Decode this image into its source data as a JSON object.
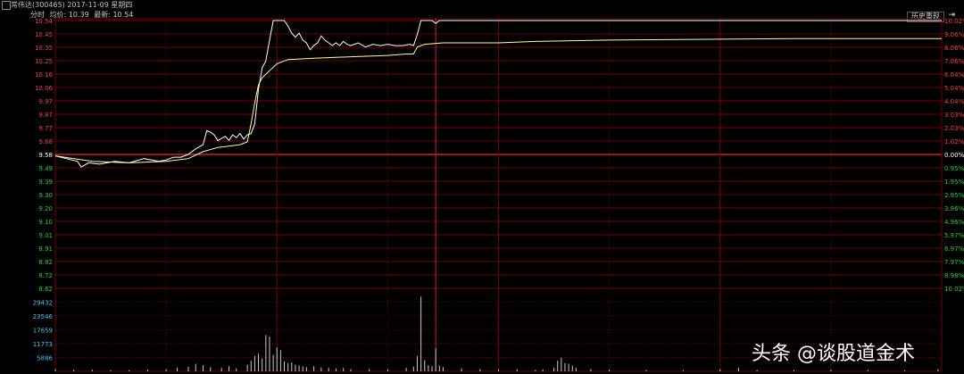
{
  "window": {
    "title": "常伟达(300465) 2017-11-09 星期四",
    "legend_time": "分时",
    "legend_avg": "均价: 10.39",
    "legend_last": "最新: 10.54",
    "history_button": "历史重现",
    "history_arrow": "⇥"
  },
  "watermark": "头条 @谈股道金术",
  "colors": {
    "background": "#000000",
    "grid": "#7a0000",
    "price_line": "#ffffff",
    "avg_line": "#ffff99",
    "prev_close_line": "#cc2222",
    "up_label": "#ff4040",
    "down_label": "#30d030",
    "volume_label": "#4fc3f7",
    "volume_bar": "#c8c8c8"
  },
  "chart_data": {
    "type": "line",
    "title": "",
    "xlabel": "",
    "ylabel": "",
    "prev_close": 9.58,
    "ylim": [
      8.62,
      10.54
    ],
    "y_ticks_left": [
      "10.54",
      "10.45",
      "10.35",
      "10.25",
      "10.16",
      "10.06",
      "9.97",
      "9.87",
      "9.77",
      "9.68",
      "9.58",
      "9.49",
      "9.39",
      "9.30",
      "9.20",
      "9.10",
      "9.01",
      "8.91",
      "8.82",
      "8.72",
      "8.62"
    ],
    "y_ticks_right": [
      "10.02%",
      "9.06%",
      "8.06%",
      "7.06%",
      "6.04%",
      "5.04%",
      "4.04%",
      "3.03%",
      "2.03%",
      "1.02%",
      "0.00%",
      "0.95%",
      "1.95%",
      "2.95%",
      "3.96%",
      "4.96%",
      "5.97%",
      "6.97%",
      "7.97%",
      "8.98%",
      "10.02%"
    ],
    "volume_ticks": [
      "29432",
      "23546",
      "17659",
      "11773",
      "5886"
    ],
    "volume_max": 35318,
    "minutes": 240,
    "marker_minute": 103,
    "series": [
      {
        "name": "",
        "role": "price",
        "points": [
          [
            0,
            9.57
          ],
          [
            3,
            9.55
          ],
          [
            6,
            9.53
          ],
          [
            7,
            9.49
          ],
          [
            9,
            9.52
          ],
          [
            12,
            9.51
          ],
          [
            16,
            9.53
          ],
          [
            20,
            9.52
          ],
          [
            24,
            9.55
          ],
          [
            28,
            9.53
          ],
          [
            30,
            9.54
          ],
          [
            32,
            9.56
          ],
          [
            34,
            9.56
          ],
          [
            36,
            9.58
          ],
          [
            38,
            9.62
          ],
          [
            40,
            9.65
          ],
          [
            41,
            9.75
          ],
          [
            42,
            9.74
          ],
          [
            43,
            9.72
          ],
          [
            44,
            9.68
          ],
          [
            46,
            9.71
          ],
          [
            47,
            9.68
          ],
          [
            48,
            9.72
          ],
          [
            49,
            9.7
          ],
          [
            50,
            9.73
          ],
          [
            51,
            9.69
          ],
          [
            52,
            9.72
          ],
          [
            53,
            9.73
          ],
          [
            54,
            9.8
          ],
          [
            55,
            10.05
          ],
          [
            56,
            10.2
          ],
          [
            57,
            10.25
          ],
          [
            58,
            10.4
          ],
          [
            59,
            10.54
          ],
          [
            60,
            10.54
          ],
          [
            61,
            10.54
          ],
          [
            62,
            10.54
          ],
          [
            63,
            10.5
          ],
          [
            64,
            10.45
          ],
          [
            65,
            10.42
          ],
          [
            66,
            10.45
          ],
          [
            67,
            10.4
          ],
          [
            68,
            10.38
          ],
          [
            69,
            10.33
          ],
          [
            70,
            10.36
          ],
          [
            71,
            10.38
          ],
          [
            72,
            10.43
          ],
          [
            73,
            10.4
          ],
          [
            74,
            10.38
          ],
          [
            75,
            10.36
          ],
          [
            76,
            10.38
          ],
          [
            77,
            10.36
          ],
          [
            78,
            10.39
          ],
          [
            79,
            10.37
          ],
          [
            80,
            10.36
          ],
          [
            82,
            10.38
          ],
          [
            84,
            10.35
          ],
          [
            86,
            10.37
          ],
          [
            88,
            10.36
          ],
          [
            90,
            10.37
          ],
          [
            92,
            10.36
          ],
          [
            94,
            10.36
          ],
          [
            96,
            10.37
          ],
          [
            97,
            10.36
          ],
          [
            98,
            10.44
          ],
          [
            99,
            10.54
          ],
          [
            101,
            10.54
          ],
          [
            102,
            10.54
          ],
          [
            103,
            10.52
          ],
          [
            104,
            10.54
          ],
          [
            106,
            10.54
          ],
          [
            240,
            10.54
          ]
        ]
      },
      {
        "name": "",
        "role": "average",
        "points": [
          [
            0,
            9.57
          ],
          [
            10,
            9.53
          ],
          [
            20,
            9.52
          ],
          [
            30,
            9.53
          ],
          [
            36,
            9.55
          ],
          [
            40,
            9.6
          ],
          [
            44,
            9.63
          ],
          [
            50,
            9.65
          ],
          [
            52,
            9.67
          ],
          [
            53,
            9.8
          ],
          [
            54,
            9.95
          ],
          [
            55,
            10.08
          ],
          [
            56,
            10.13
          ],
          [
            58,
            10.18
          ],
          [
            60,
            10.23
          ],
          [
            63,
            10.26
          ],
          [
            70,
            10.27
          ],
          [
            80,
            10.28
          ],
          [
            90,
            10.29
          ],
          [
            95,
            10.3
          ],
          [
            97,
            10.3
          ],
          [
            98,
            10.35
          ],
          [
            100,
            10.37
          ],
          [
            105,
            10.38
          ],
          [
            120,
            10.38
          ],
          [
            130,
            10.39
          ],
          [
            150,
            10.4
          ],
          [
            200,
            10.41
          ],
          [
            240,
            10.41
          ]
        ]
      }
    ],
    "volume": [
      [
        0,
        900
      ],
      [
        5,
        600
      ],
      [
        10,
        700
      ],
      [
        15,
        500
      ],
      [
        20,
        600
      ],
      [
        25,
        800
      ],
      [
        30,
        900
      ],
      [
        33,
        1500
      ],
      [
        36,
        2000
      ],
      [
        38,
        3200
      ],
      [
        40,
        2600
      ],
      [
        42,
        1800
      ],
      [
        45,
        1500
      ],
      [
        47,
        2200
      ],
      [
        49,
        1200
      ],
      [
        52,
        2800
      ],
      [
        53,
        4500
      ],
      [
        54,
        6500
      ],
      [
        55,
        7500
      ],
      [
        56,
        5500
      ],
      [
        57,
        15500
      ],
      [
        58,
        14800
      ],
      [
        59,
        7000
      ],
      [
        60,
        10200
      ],
      [
        61,
        9000
      ],
      [
        62,
        4200
      ],
      [
        63,
        3500
      ],
      [
        64,
        3800
      ],
      [
        65,
        2800
      ],
      [
        66,
        2500
      ],
      [
        67,
        2100
      ],
      [
        68,
        1800
      ],
      [
        70,
        2200
      ],
      [
        72,
        1600
      ],
      [
        74,
        1400
      ],
      [
        76,
        1200
      ],
      [
        78,
        1400
      ],
      [
        80,
        900
      ],
      [
        85,
        1000
      ],
      [
        90,
        900
      ],
      [
        95,
        1500
      ],
      [
        97,
        2000
      ],
      [
        98,
        6500
      ],
      [
        99,
        31800
      ],
      [
        100,
        4800
      ],
      [
        101,
        2600
      ],
      [
        102,
        2200
      ],
      [
        103,
        9800
      ],
      [
        104,
        2500
      ],
      [
        105,
        1800
      ],
      [
        110,
        1200
      ],
      [
        115,
        1000
      ],
      [
        120,
        800
      ],
      [
        125,
        900
      ],
      [
        130,
        600
      ],
      [
        132,
        900
      ],
      [
        135,
        1500
      ],
      [
        136,
        4500
      ],
      [
        137,
        5800
      ],
      [
        138,
        3500
      ],
      [
        139,
        3200
      ],
      [
        140,
        2500
      ],
      [
        141,
        1500
      ],
      [
        145,
        1000
      ],
      [
        150,
        700
      ],
      [
        160,
        600
      ],
      [
        170,
        500
      ],
      [
        180,
        900
      ],
      [
        185,
        1500
      ],
      [
        190,
        600
      ],
      [
        200,
        500
      ],
      [
        210,
        700
      ],
      [
        220,
        600
      ],
      [
        230,
        500
      ],
      [
        239,
        900
      ]
    ]
  }
}
